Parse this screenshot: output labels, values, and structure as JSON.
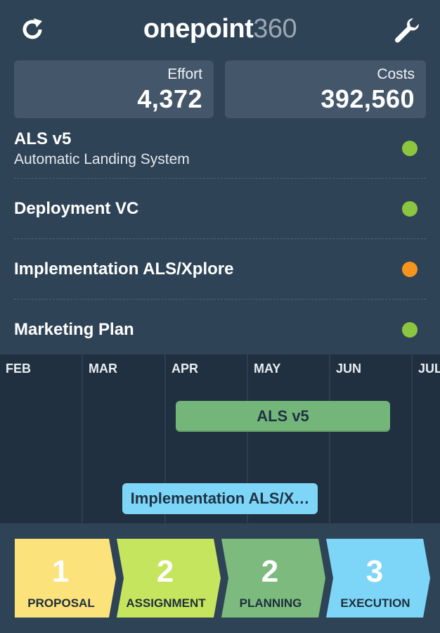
{
  "header": {
    "logo_bold": "onepoint",
    "logo_light": "360",
    "refresh_icon": "refresh-icon",
    "settings_icon": "wrench-icon"
  },
  "stats": {
    "effort": {
      "label": "Effort",
      "value": "4,372"
    },
    "costs": {
      "label": "Costs",
      "value": "392,560"
    }
  },
  "projects": [
    {
      "title": "ALS v5",
      "subtitle": "Automatic Landing System",
      "status_color": "#8cc63f"
    },
    {
      "title": "Deployment VC",
      "status_color": "#8cc63f"
    },
    {
      "title": "Implementation ALS/Xplore",
      "status_color": "#f7941d"
    },
    {
      "title": "Marketing Plan",
      "status_color": "#8cc63f"
    }
  ],
  "timeline": {
    "months": [
      "FEB",
      "MAR",
      "APR",
      "MAY",
      "JUN",
      "JUL"
    ],
    "bars": [
      {
        "label": "ALS v5",
        "color": "#74b679"
      },
      {
        "label": "Implementation ALS/X…",
        "color": "#7dd6f8"
      }
    ]
  },
  "phases": [
    {
      "count": "1",
      "label": "PROPOSAL",
      "color": "#fbe27a"
    },
    {
      "count": "2",
      "label": "ASSIGNMENT",
      "color": "#c6e55e"
    },
    {
      "count": "2",
      "label": "PLANNING",
      "color": "#7cbb7d"
    },
    {
      "count": "3",
      "label": "EXECUTION",
      "color": "#7dd6f8"
    }
  ]
}
